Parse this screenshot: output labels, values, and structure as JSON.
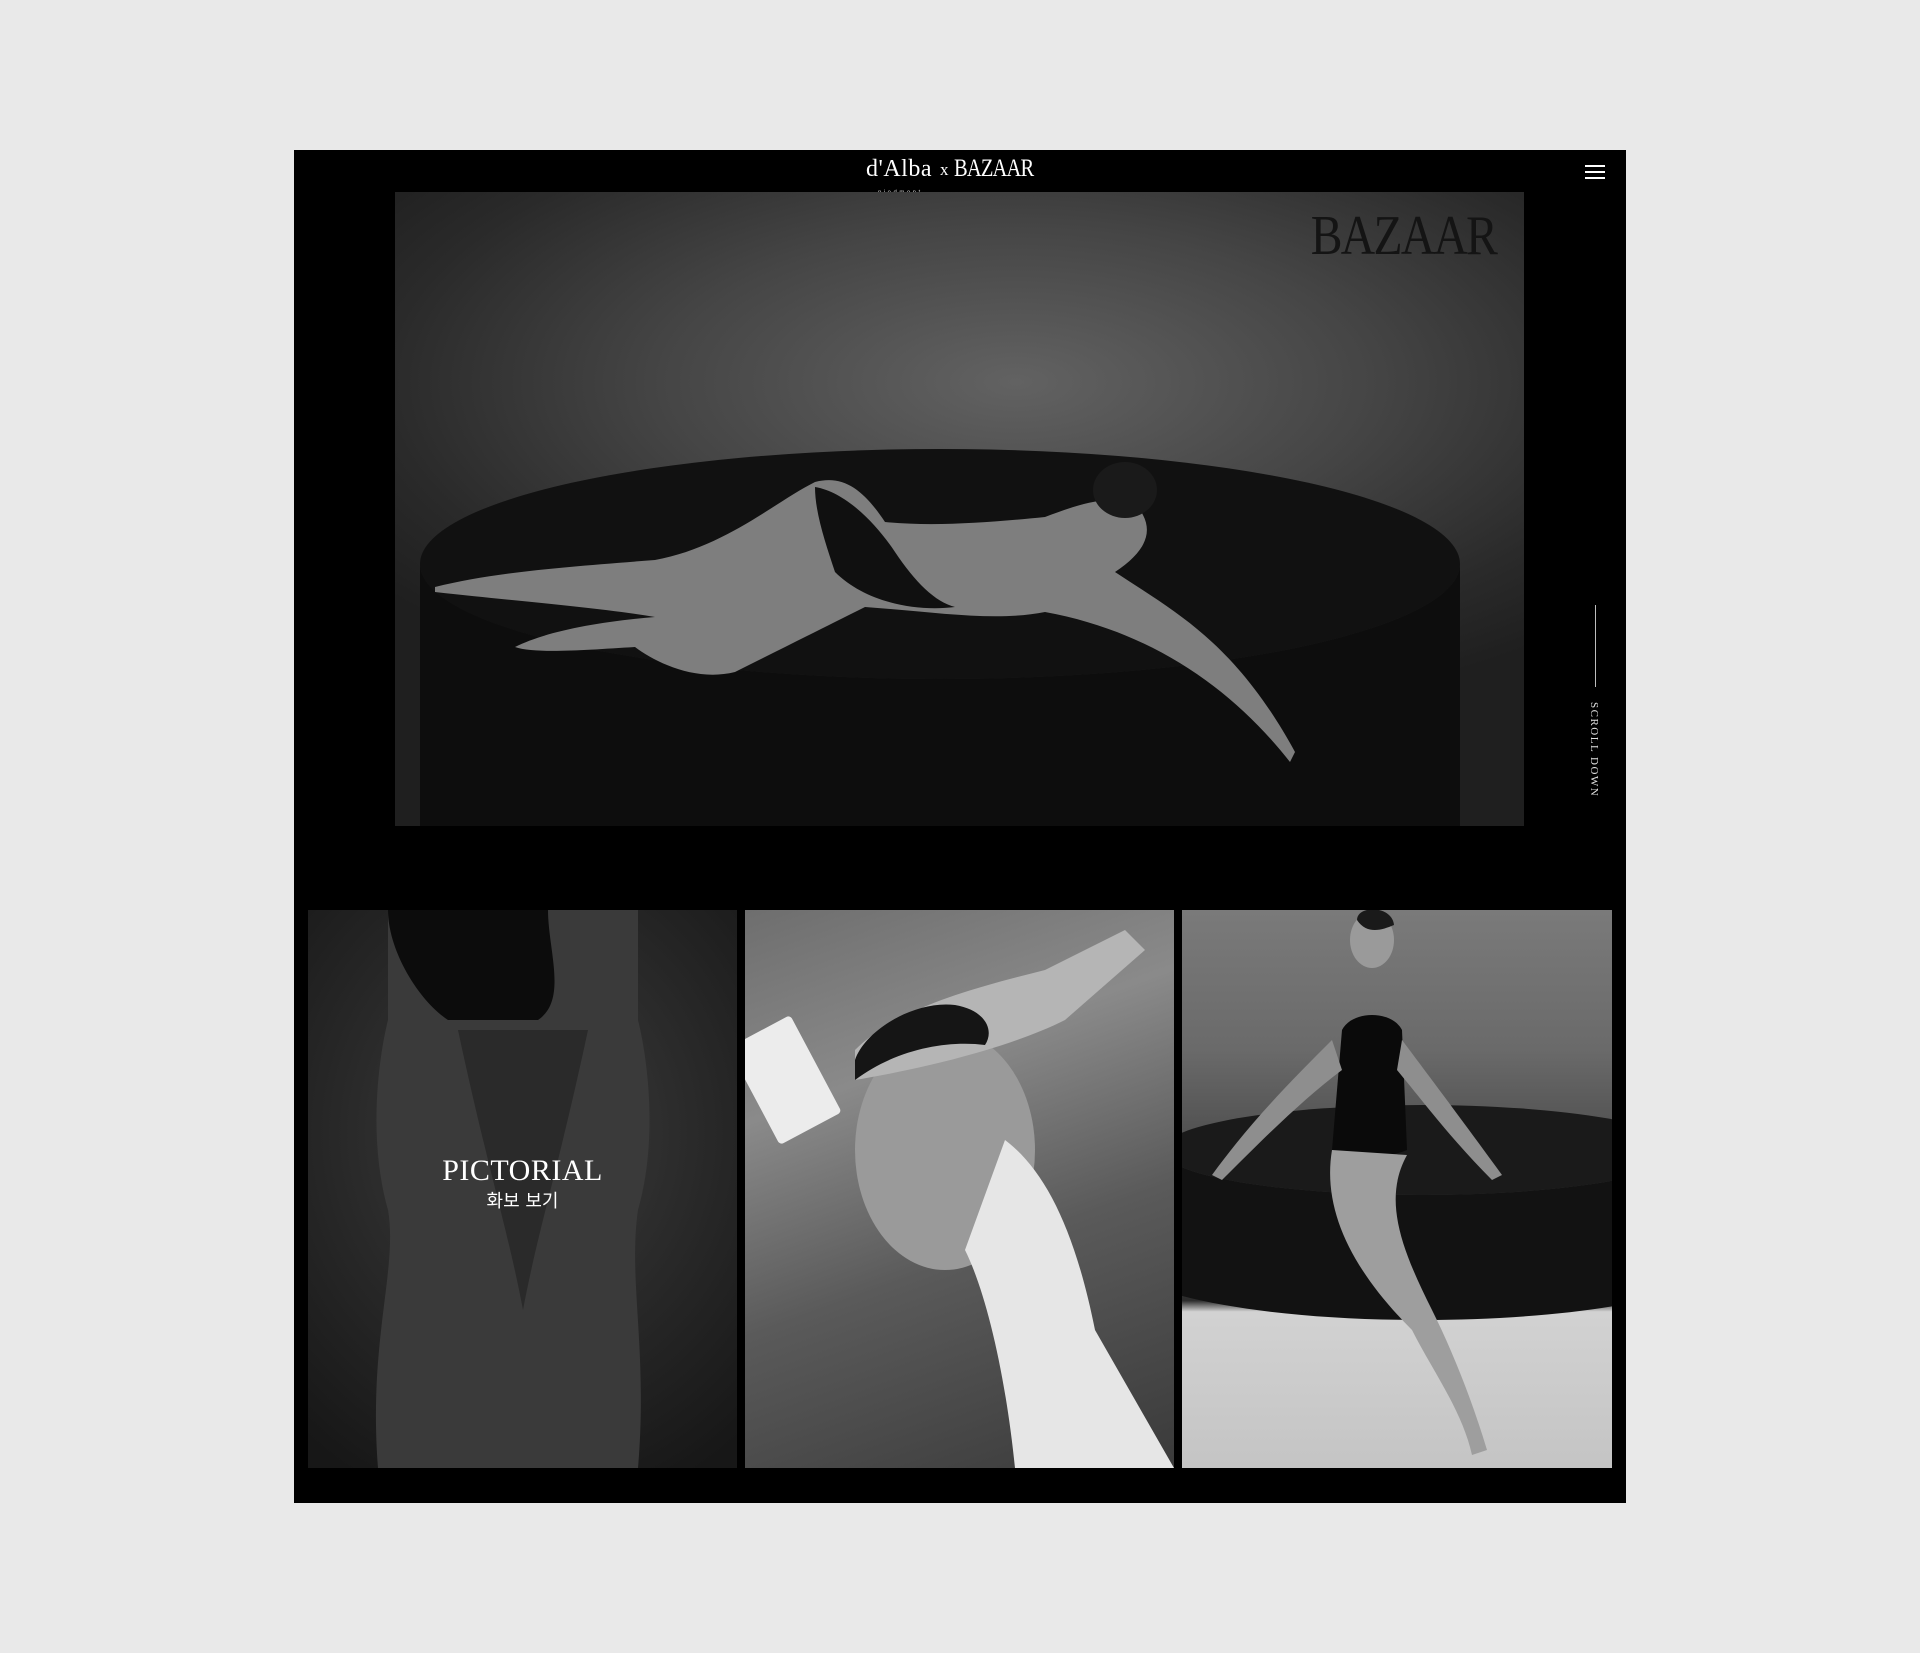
{
  "header": {
    "logo_primary": "d'Alba",
    "logo_sub": "piedmont",
    "logo_separator": "x",
    "logo_partner": "BAZAAR",
    "menu_icon": "hamburger-menu-icon"
  },
  "hero": {
    "watermark": "BAZAAR"
  },
  "scroll": {
    "label": "SCROLL DOWN"
  },
  "gallery": {
    "pictorial_title": "PICTORIAL",
    "pictorial_subtitle": "화보 보기"
  },
  "colors": {
    "background": "#e9e9e9",
    "screen": "#000000",
    "text": "#ffffff"
  }
}
